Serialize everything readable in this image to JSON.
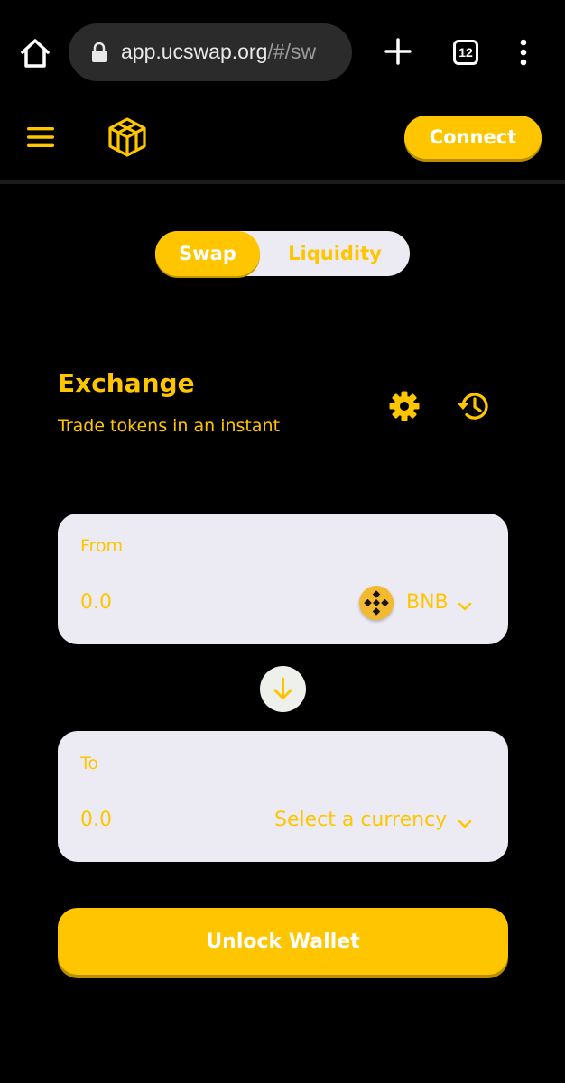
{
  "browser": {
    "url_main": "app.ucswap.org",
    "url_rest": "/#/sw",
    "tab_count": "12",
    "icons": [
      "home-icon",
      "lock-icon",
      "plus-icon",
      "tabs-icon",
      "more-vert-icon"
    ]
  },
  "header": {
    "connect_label": "Connect",
    "icons": [
      "hamburger-icon",
      "ucswap-logo-icon"
    ]
  },
  "toggle": {
    "swap_label": "Swap",
    "liquidity_label": "Liquidity"
  },
  "exchange": {
    "title": "Exchange",
    "subtitle": "Trade tokens in an instant",
    "icons": [
      "gear-icon",
      "history-icon"
    ]
  },
  "from_card": {
    "label": "From",
    "amount": "0.0",
    "token": "BNB",
    "icon": "bnb-icon"
  },
  "to_card": {
    "label": "To",
    "amount": "0.0",
    "token_placeholder": "Select a currency"
  },
  "actions": {
    "unlock_label": "Unlock Wallet"
  },
  "colors": {
    "background": "#000000",
    "accent": "#ffc600",
    "card": "#ecebf3"
  }
}
